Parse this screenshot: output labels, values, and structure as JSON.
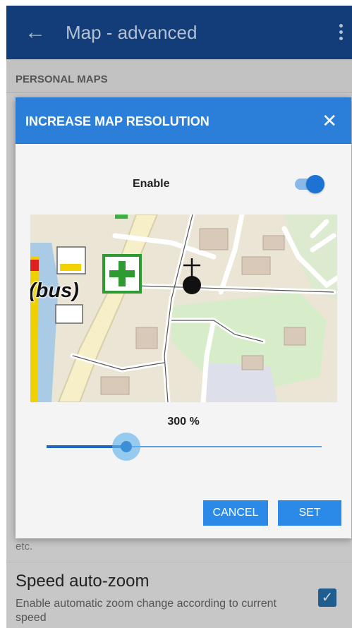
{
  "appbar": {
    "title": "Map - advanced",
    "back_icon": "arrow-left-icon",
    "more_icon": "more-vertical-icon",
    "color": "#123d78"
  },
  "screen": {
    "section_header": "PERSONAL MAPS",
    "partial_text": "etc.",
    "speed_auto_zoom": {
      "title": "Speed auto-zoom",
      "summary": "Enable automatic zoom change according to current speed",
      "checked": true
    }
  },
  "dialog": {
    "title": "INCREASE MAP RESOLUTION",
    "close_icon": "close-icon",
    "header_color": "#2b7fd8",
    "enable_label": "Enable",
    "enable_on": true,
    "map": {
      "bus_label": "(bus)",
      "first_aid_icon": "first-aid-cross-icon",
      "marker_icon": "location-marker-icon"
    },
    "zoom_value": "300 %",
    "slider_fraction": 0.29,
    "cancel_label": "CANCEL",
    "set_label": "SET",
    "button_color": "#2b8ae8"
  }
}
